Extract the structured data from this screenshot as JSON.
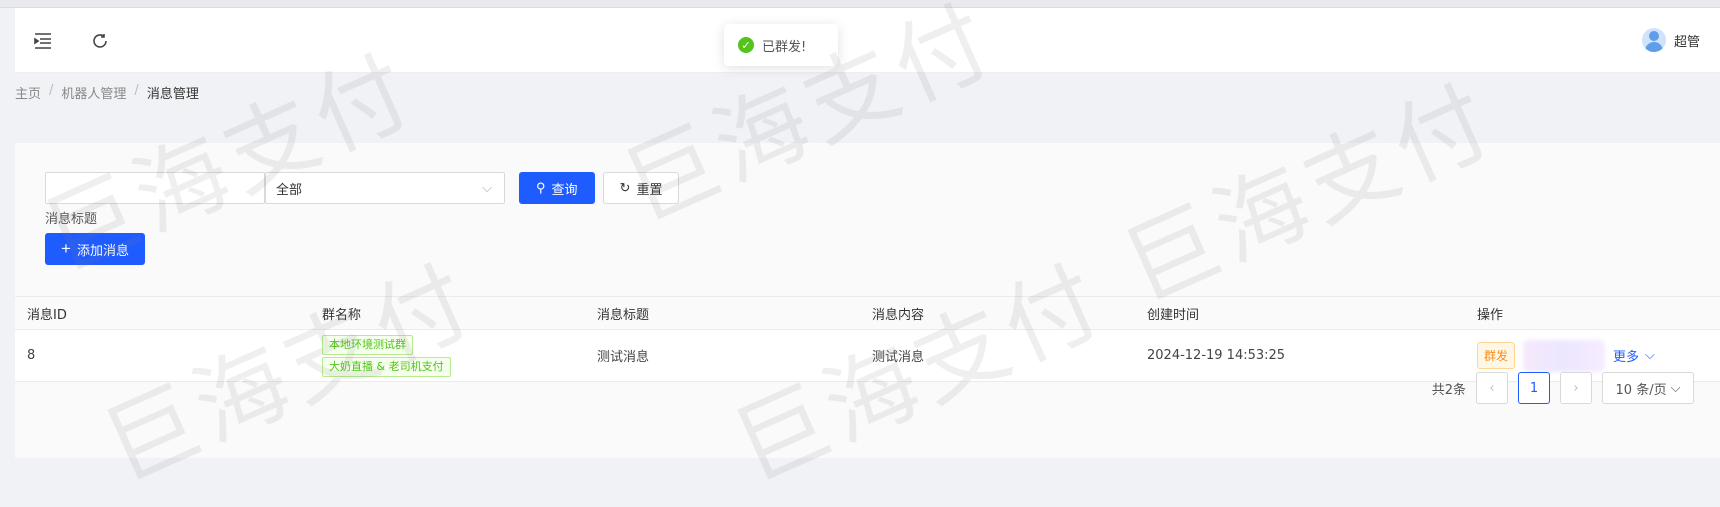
{
  "header": {
    "user_name": "超管",
    "toast_text": "已群发!"
  },
  "breadcrumb": {
    "items": [
      "主页",
      "机器人管理",
      "消息管理"
    ]
  },
  "search": {
    "title_input_value": "",
    "title_label": "消息标题",
    "type_select_value": "全部",
    "query_label": "查询",
    "reset_label": "重置",
    "add_label": "添加消息"
  },
  "table": {
    "columns": [
      "消息ID",
      "群名称",
      "消息标题",
      "消息内容",
      "创建时间",
      "操作"
    ],
    "rows": [
      {
        "id": "8",
        "groups": [
          "本地环境测试群",
          "大奶直播 & 老司机支付"
        ],
        "title": "测试消息",
        "content": "测试消息",
        "created": "2024-12-19 14:53:25",
        "broadcast": "群发",
        "more": "更多"
      }
    ]
  },
  "pagination": {
    "total": "共2条",
    "current": "1",
    "page_size": "10 条/页"
  },
  "watermark": "巨海支付",
  "colors": {
    "primary": "#1f5cff",
    "success": "#52c41a",
    "warning": "#fa8c16"
  }
}
